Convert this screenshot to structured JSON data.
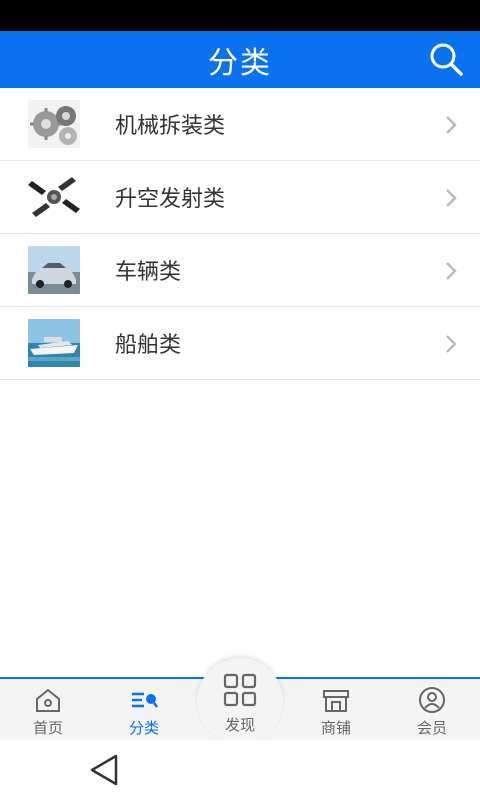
{
  "header": {
    "title": "分类"
  },
  "categories": [
    {
      "label": "机械拆装类",
      "thumb": "gears-thumbnail"
    },
    {
      "label": "升空发射类",
      "thumb": "satellite-thumbnail"
    },
    {
      "label": "车辆类",
      "thumb": "car-thumbnail"
    },
    {
      "label": "船舶类",
      "thumb": "ship-thumbnail"
    }
  ],
  "bottom_nav": {
    "items": [
      {
        "label": "首页",
        "icon": "home-icon"
      },
      {
        "label": "分类",
        "icon": "category-icon",
        "active": true
      },
      {
        "label": "发现",
        "icon": "grid-icon"
      },
      {
        "label": "商铺",
        "icon": "store-icon"
      },
      {
        "label": "会员",
        "icon": "user-icon"
      }
    ]
  },
  "colors": {
    "accent": "#0a72ee",
    "nav_bg": "#f4f4f4",
    "text": "#333333",
    "muted": "#666666"
  }
}
